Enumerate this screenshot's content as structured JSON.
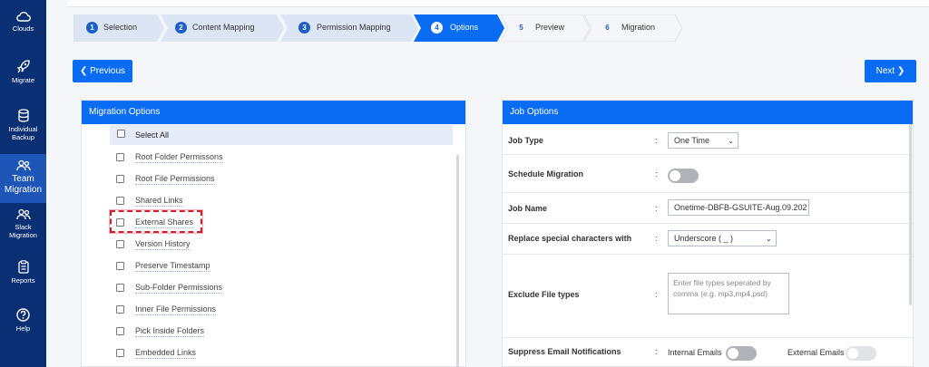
{
  "sidebar": {
    "items": [
      {
        "label": "Clouds",
        "icon": "cloud-icon"
      },
      {
        "label": "Migrate",
        "icon": "rocket-icon"
      },
      {
        "label": "Individual Backup",
        "icon": "database-icon"
      },
      {
        "label": "Team Migration",
        "icon": "team-icon"
      },
      {
        "label": "Slack Migration",
        "icon": "team-icon"
      },
      {
        "label": "Reports",
        "icon": "report-icon"
      },
      {
        "label": "Help",
        "icon": "help-icon"
      }
    ]
  },
  "stepper": {
    "steps": [
      {
        "num": "1",
        "label": "Selection"
      },
      {
        "num": "2",
        "label": "Content Mapping"
      },
      {
        "num": "3",
        "label": "Permission Mapping"
      },
      {
        "num": "4",
        "label": "Options"
      },
      {
        "num": "5",
        "label": "Preview"
      },
      {
        "num": "6",
        "label": "Migration"
      }
    ]
  },
  "nav": {
    "previous": "Previous",
    "next": "Next"
  },
  "migration_options": {
    "title": "Migration Options",
    "select_all": "Select All",
    "items": [
      "Root Folder Permissons",
      "Root File Permissions",
      "Shared Links",
      "External Shares",
      "Version History",
      "Preserve Timestamp",
      "Sub-Folder Permissions",
      "Inner File Permissions",
      "Pick Inside Folders",
      "Embedded Links"
    ]
  },
  "job_options": {
    "title": "Job Options",
    "job_type": {
      "label": "Job Type",
      "value": "One Time"
    },
    "schedule": {
      "label": "Schedule Migration"
    },
    "job_name": {
      "label": "Job Name",
      "value": "Onetime-DBFB-GSUITE-Aug.09.202"
    },
    "replace": {
      "label": "Replace special characters with",
      "value": "Underscore ( _ )"
    },
    "exclude": {
      "label": "Exclude File types",
      "placeholder": "Enter file types seperated by comma (e.g. mp3,mp4,psd)"
    },
    "suppress": {
      "label": "Suppress Email Notifications",
      "internal": "Internal Emails",
      "external": "External Emails"
    },
    "colon": ":"
  },
  "colors": {
    "accent": "#0a6cf2",
    "sidebar": "#0b2f73",
    "highlight": "#d21c2a"
  }
}
